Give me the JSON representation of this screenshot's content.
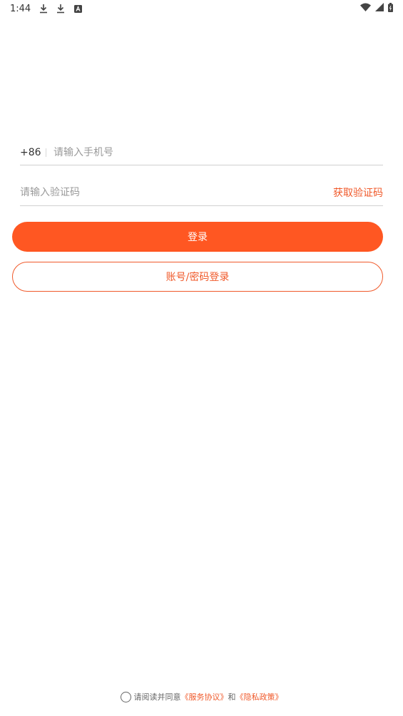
{
  "status_bar": {
    "time": "1:44",
    "left_icons": [
      "download-icon",
      "download-icon",
      "a-box-icon"
    ],
    "right_icons": [
      "wifi-icon",
      "signal-icon",
      "battery-icon"
    ]
  },
  "phone": {
    "country_code": "+86",
    "placeholder": "请输入手机号",
    "value": ""
  },
  "code": {
    "placeholder": "请输入验证码",
    "value": "",
    "get_code_label": "获取验证码"
  },
  "buttons": {
    "login_label": "登录",
    "password_login_label": "账号/密码登录"
  },
  "agreement": {
    "prefix": "请阅读并同意",
    "service_link": "《服务协议》",
    "and": "和",
    "privacy_link": "《隐私政策》",
    "checked": false
  },
  "colors": {
    "accent": "#ff5722",
    "link": "#f0592a",
    "text": "#333333",
    "placeholder": "#9a9a9a",
    "divider": "#d0d0d0"
  }
}
